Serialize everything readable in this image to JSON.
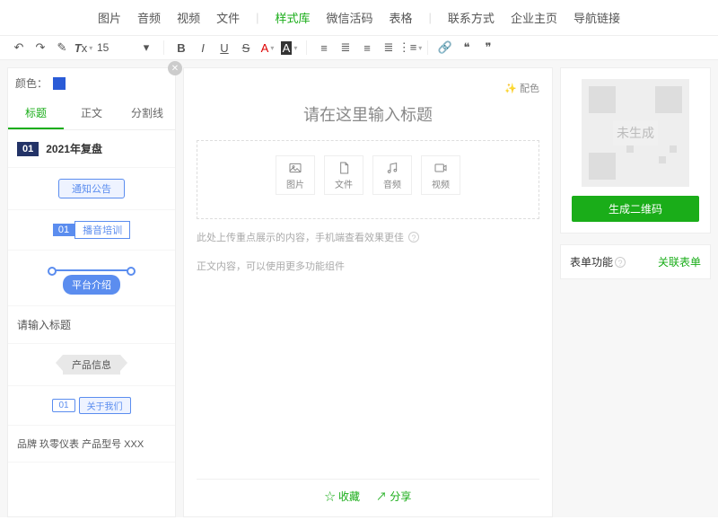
{
  "topMenu": {
    "items1": [
      "图片",
      "音频",
      "视频",
      "文件"
    ],
    "items2": [
      "样式库",
      "微信活码",
      "表格"
    ],
    "items3": [
      "联系方式",
      "企业主页",
      "导航链接"
    ],
    "activeIndex": 4
  },
  "toolbar": {
    "fontSize": "15"
  },
  "sidebar": {
    "colorLabel": "颜色：",
    "tabs": [
      "标题",
      "正文",
      "分割线"
    ],
    "activeTab": 0,
    "styles": {
      "s1": {
        "num": "01",
        "text": "2021年复盘"
      },
      "s2": "通知公告",
      "s3": {
        "num": "01",
        "text": "播音培训"
      },
      "s4": "平台介绍",
      "s5": "请输入标题",
      "s6": "产品信息",
      "s7": {
        "num": "01",
        "text": "关于我们"
      },
      "s8": "品牌 玖零仪表    产品型号 XXX"
    }
  },
  "editor": {
    "colorMatch": "配色",
    "titlePlaceholder": "请在这里输入标题",
    "insertTypes": {
      "image": "图片",
      "file": "文件",
      "audio": "音频",
      "video": "视频"
    },
    "note": "此处上传重点展示的内容，手机端查看效果更佳",
    "bodyPlaceholder": "正文内容，可以使用更多功能组件",
    "footer": {
      "fav": "☆ 收藏",
      "share": "↗ 分享"
    }
  },
  "right": {
    "qrPlaceholder": "未生成",
    "genBtn": "生成二维码",
    "formLabel": "表单功能",
    "formLink": "关联表单"
  }
}
